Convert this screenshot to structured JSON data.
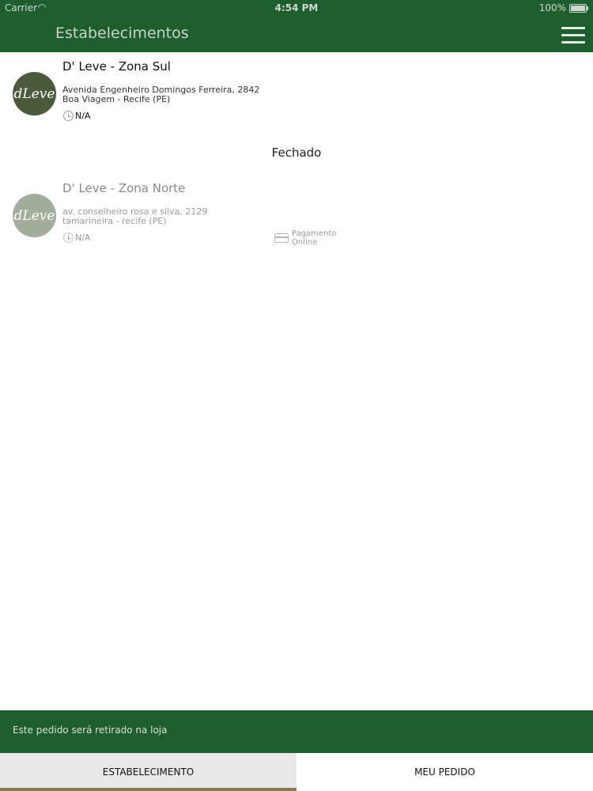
{
  "status_bar": {
    "carrier": "Carrier",
    "time": "4:54 PM",
    "battery": "100%"
  },
  "header": {
    "title": "Estabelecimentos",
    "menu_icon": "hamburger-menu-icon"
  },
  "stores": [
    {
      "name": "D' Leve - Zona Sul",
      "logo_text": "dLeve",
      "address_line1": "Avenida Engenheiro Domingos Ferreira, 2842",
      "address_line2": "Boa Viagem - Recife (PE)",
      "hours": "N/A",
      "logo_color": "#4b5a3a",
      "closed": false
    },
    {
      "name": "D' Leve - Zona Norte",
      "logo_text": "dLeve",
      "address_line1": "av. conselheiro rosa e silva, 2129",
      "address_line2": "tamarineira - recife (PE)",
      "hours": "N/A",
      "payment_label": "Pagamento Online",
      "logo_color": "#a3ad9b",
      "closed": true
    }
  ],
  "section_closed_label": "Fechado",
  "footer": {
    "pickup_message": "Este pedido será retirado na loja",
    "tabs": [
      {
        "label": "ESTABELECIMENTO",
        "active": true
      },
      {
        "label": "MEU PEDIDO",
        "active": false
      }
    ]
  },
  "colors": {
    "brand_green": "#1e5e2e",
    "active_tab_indicator": "#8b7a4c"
  }
}
